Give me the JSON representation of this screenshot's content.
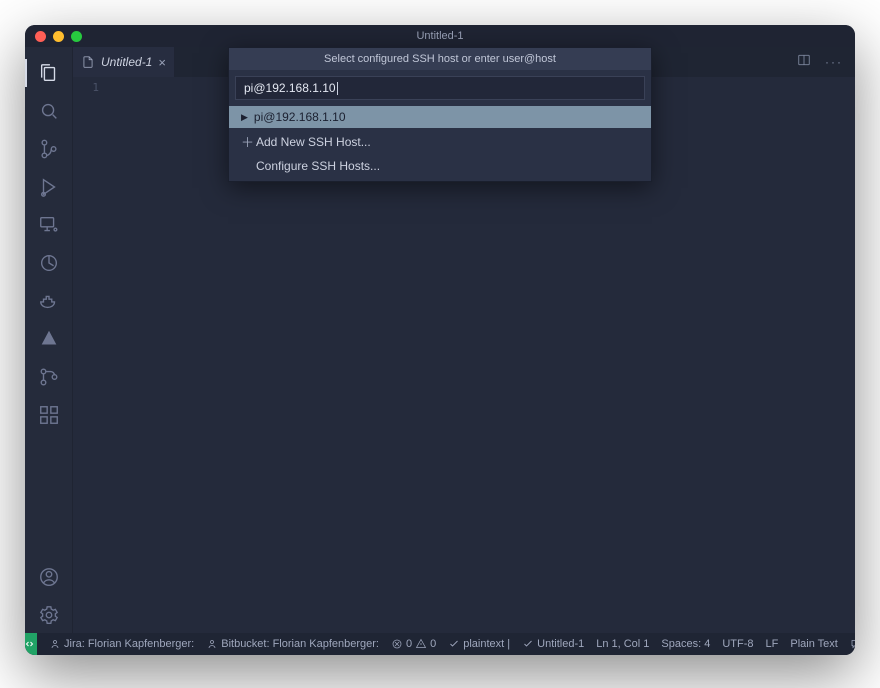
{
  "window": {
    "title": "Untitled-1"
  },
  "tab": {
    "label": "Untitled-1",
    "line_number": "1"
  },
  "quickpick": {
    "header": "Select configured SSH host or enter user@host",
    "input_value": "pi@192.168.1.10",
    "items": [
      {
        "kind": "host",
        "label": "pi@192.168.1.10"
      },
      {
        "kind": "add",
        "label": "Add New SSH Host..."
      },
      {
        "kind": "config",
        "label": "Configure SSH Hosts..."
      }
    ]
  },
  "status": {
    "jira": "Jira: Florian Kapfenberger:",
    "bitbucket": "Bitbucket: Florian Kapfenberger:",
    "errors": "0",
    "warnings": "0",
    "plaintext": "plaintext |",
    "file_check": "Untitled-1",
    "ln_col": "Ln 1, Col 1",
    "spaces": "Spaces: 4",
    "encoding": "UTF-8",
    "eol": "LF",
    "language": "Plain Text"
  }
}
